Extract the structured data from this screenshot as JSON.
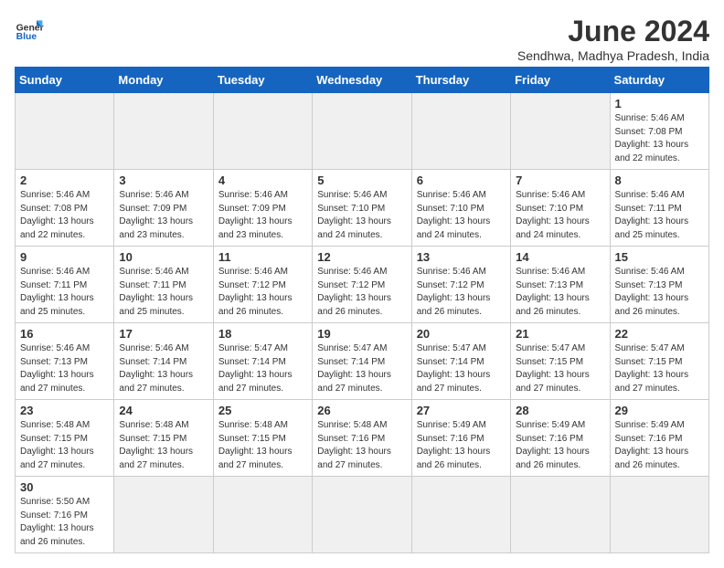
{
  "header": {
    "logo_general": "General",
    "logo_blue": "Blue",
    "month_title": "June 2024",
    "location": "Sendhwa, Madhya Pradesh, India"
  },
  "weekdays": [
    "Sunday",
    "Monday",
    "Tuesday",
    "Wednesday",
    "Thursday",
    "Friday",
    "Saturday"
  ],
  "weeks": [
    [
      {
        "day": "",
        "info": ""
      },
      {
        "day": "",
        "info": ""
      },
      {
        "day": "",
        "info": ""
      },
      {
        "day": "",
        "info": ""
      },
      {
        "day": "",
        "info": ""
      },
      {
        "day": "",
        "info": ""
      },
      {
        "day": "1",
        "info": "Sunrise: 5:46 AM\nSunset: 7:08 PM\nDaylight: 13 hours\nand 22 minutes."
      }
    ],
    [
      {
        "day": "2",
        "info": "Sunrise: 5:46 AM\nSunset: 7:08 PM\nDaylight: 13 hours\nand 22 minutes."
      },
      {
        "day": "3",
        "info": "Sunrise: 5:46 AM\nSunset: 7:09 PM\nDaylight: 13 hours\nand 23 minutes."
      },
      {
        "day": "4",
        "info": "Sunrise: 5:46 AM\nSunset: 7:09 PM\nDaylight: 13 hours\nand 23 minutes."
      },
      {
        "day": "5",
        "info": "Sunrise: 5:46 AM\nSunset: 7:10 PM\nDaylight: 13 hours\nand 24 minutes."
      },
      {
        "day": "6",
        "info": "Sunrise: 5:46 AM\nSunset: 7:10 PM\nDaylight: 13 hours\nand 24 minutes."
      },
      {
        "day": "7",
        "info": "Sunrise: 5:46 AM\nSunset: 7:10 PM\nDaylight: 13 hours\nand 24 minutes."
      },
      {
        "day": "8",
        "info": "Sunrise: 5:46 AM\nSunset: 7:11 PM\nDaylight: 13 hours\nand 25 minutes."
      }
    ],
    [
      {
        "day": "9",
        "info": "Sunrise: 5:46 AM\nSunset: 7:11 PM\nDaylight: 13 hours\nand 25 minutes."
      },
      {
        "day": "10",
        "info": "Sunrise: 5:46 AM\nSunset: 7:11 PM\nDaylight: 13 hours\nand 25 minutes."
      },
      {
        "day": "11",
        "info": "Sunrise: 5:46 AM\nSunset: 7:12 PM\nDaylight: 13 hours\nand 26 minutes."
      },
      {
        "day": "12",
        "info": "Sunrise: 5:46 AM\nSunset: 7:12 PM\nDaylight: 13 hours\nand 26 minutes."
      },
      {
        "day": "13",
        "info": "Sunrise: 5:46 AM\nSunset: 7:12 PM\nDaylight: 13 hours\nand 26 minutes."
      },
      {
        "day": "14",
        "info": "Sunrise: 5:46 AM\nSunset: 7:13 PM\nDaylight: 13 hours\nand 26 minutes."
      },
      {
        "day": "15",
        "info": "Sunrise: 5:46 AM\nSunset: 7:13 PM\nDaylight: 13 hours\nand 26 minutes."
      }
    ],
    [
      {
        "day": "16",
        "info": "Sunrise: 5:46 AM\nSunset: 7:13 PM\nDaylight: 13 hours\nand 27 minutes."
      },
      {
        "day": "17",
        "info": "Sunrise: 5:46 AM\nSunset: 7:14 PM\nDaylight: 13 hours\nand 27 minutes."
      },
      {
        "day": "18",
        "info": "Sunrise: 5:47 AM\nSunset: 7:14 PM\nDaylight: 13 hours\nand 27 minutes."
      },
      {
        "day": "19",
        "info": "Sunrise: 5:47 AM\nSunset: 7:14 PM\nDaylight: 13 hours\nand 27 minutes."
      },
      {
        "day": "20",
        "info": "Sunrise: 5:47 AM\nSunset: 7:14 PM\nDaylight: 13 hours\nand 27 minutes."
      },
      {
        "day": "21",
        "info": "Sunrise: 5:47 AM\nSunset: 7:15 PM\nDaylight: 13 hours\nand 27 minutes."
      },
      {
        "day": "22",
        "info": "Sunrise: 5:47 AM\nSunset: 7:15 PM\nDaylight: 13 hours\nand 27 minutes."
      }
    ],
    [
      {
        "day": "23",
        "info": "Sunrise: 5:48 AM\nSunset: 7:15 PM\nDaylight: 13 hours\nand 27 minutes."
      },
      {
        "day": "24",
        "info": "Sunrise: 5:48 AM\nSunset: 7:15 PM\nDaylight: 13 hours\nand 27 minutes."
      },
      {
        "day": "25",
        "info": "Sunrise: 5:48 AM\nSunset: 7:15 PM\nDaylight: 13 hours\nand 27 minutes."
      },
      {
        "day": "26",
        "info": "Sunrise: 5:48 AM\nSunset: 7:16 PM\nDaylight: 13 hours\nand 27 minutes."
      },
      {
        "day": "27",
        "info": "Sunrise: 5:49 AM\nSunset: 7:16 PM\nDaylight: 13 hours\nand 26 minutes."
      },
      {
        "day": "28",
        "info": "Sunrise: 5:49 AM\nSunset: 7:16 PM\nDaylight: 13 hours\nand 26 minutes."
      },
      {
        "day": "29",
        "info": "Sunrise: 5:49 AM\nSunset: 7:16 PM\nDaylight: 13 hours\nand 26 minutes."
      }
    ],
    [
      {
        "day": "30",
        "info": "Sunrise: 5:50 AM\nSunset: 7:16 PM\nDaylight: 13 hours\nand 26 minutes."
      },
      {
        "day": "",
        "info": ""
      },
      {
        "day": "",
        "info": ""
      },
      {
        "day": "",
        "info": ""
      },
      {
        "day": "",
        "info": ""
      },
      {
        "day": "",
        "info": ""
      },
      {
        "day": "",
        "info": ""
      }
    ]
  ]
}
